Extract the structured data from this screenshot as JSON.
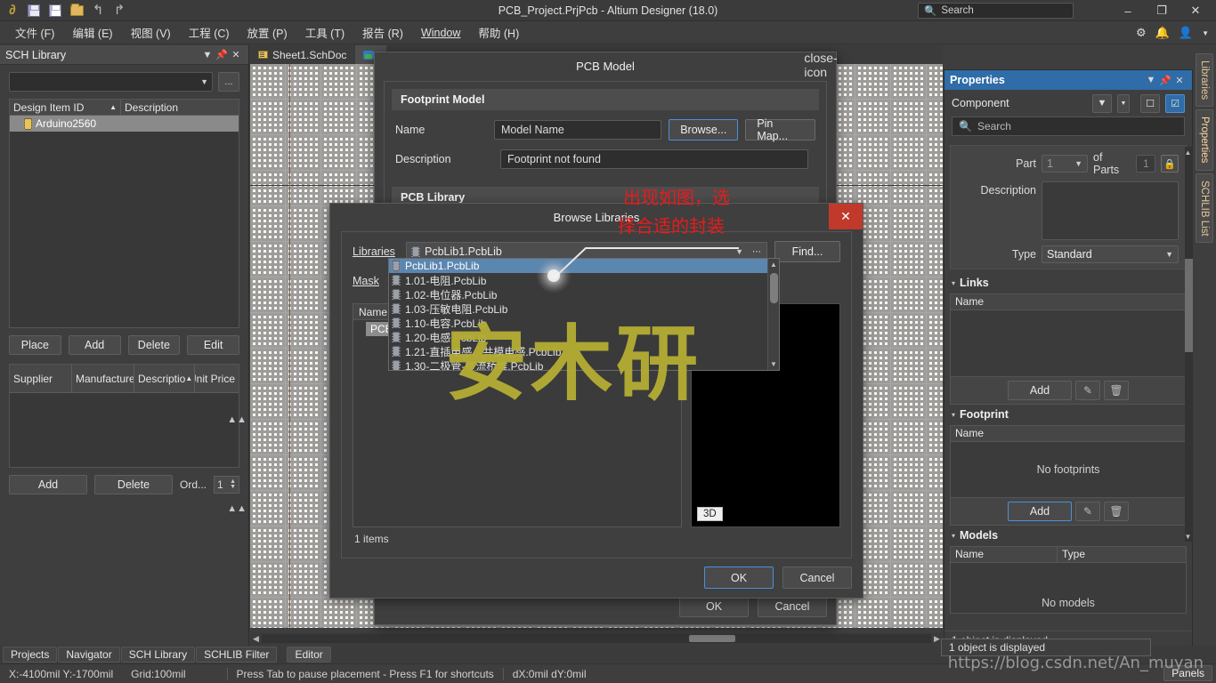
{
  "titlebar": {
    "title": "PCB_Project.PrjPcb - Altium Designer (18.0)",
    "search_placeholder": "Search",
    "search_value": "Search",
    "minimize": "–",
    "maximize": "❐",
    "close": "✕",
    "icons": [
      "altium-logo-icon",
      "save-icon",
      "save-all-icon",
      "open-folder-icon",
      "undo-icon",
      "redo-icon"
    ]
  },
  "menubar": {
    "items": [
      {
        "label": "文件 (F)"
      },
      {
        "label": "编辑 (E)"
      },
      {
        "label": "视图 (V)"
      },
      {
        "label": "工程 (C)"
      },
      {
        "label": "放置 (P)"
      },
      {
        "label": "工具 (T)"
      },
      {
        "label": "报告 (R)"
      },
      {
        "label": "Window"
      },
      {
        "label": "帮助 (H)"
      }
    ],
    "right_icons": [
      "gear-icon",
      "bell-icon",
      "user-icon",
      "chevron-down-icon"
    ]
  },
  "sch_library_panel": {
    "title": "SCH Library",
    "header_icons": [
      "chevron-down-icon",
      "pin-icon",
      "close-icon"
    ],
    "filter_value": "",
    "dots_button": "...",
    "table": {
      "columns": [
        "Design Item ID",
        "Description"
      ],
      "sort_indicator": "▲",
      "rows": [
        {
          "design_item_id": "Arduino2560",
          "description": ""
        }
      ]
    },
    "buttons_top": [
      "Place",
      "Add",
      "Delete",
      "Edit"
    ],
    "supplier_table": {
      "columns": [
        "Supplier",
        "Manufacture",
        "Descriptio",
        "Unit Price"
      ],
      "rows": []
    },
    "buttons_bottom": [
      "Add",
      "Delete"
    ],
    "order_label": "Ord...",
    "order_value": "1"
  },
  "doc_tabs": [
    {
      "label": "Sheet1.SchDoc",
      "icon": "schematic-icon",
      "active": false
    },
    {
      "label": "",
      "icon": "pcblib-icon",
      "active": true
    }
  ],
  "canvas": {
    "grid_label": "schematic-canvas"
  },
  "properties_panel": {
    "title": "Properties",
    "header_icons": [
      "chevron-down-icon",
      "pin-icon",
      "close-icon"
    ],
    "object_label": "Component",
    "filter_icon": "funnel-icon",
    "search_placeholder": "Search",
    "part_label": "Part",
    "part_value": "1",
    "of_parts_label": "of Parts",
    "of_parts_value": "1",
    "lock_icon": "lock-icon",
    "description_label": "Description",
    "description_value": "",
    "type_label": "Type",
    "type_value": "Standard",
    "sections": [
      {
        "title": "Links",
        "columns": [
          "Name"
        ],
        "empty_text": "",
        "add_label": "Add",
        "edit_icon": "pencil-icon",
        "delete_icon": "trash-icon"
      },
      {
        "title": "Footprint",
        "columns": [
          "Name"
        ],
        "empty_text": "No footprints",
        "add_label": "Add",
        "edit_icon": "pencil-icon",
        "delete_icon": "trash-icon"
      },
      {
        "title": "Models",
        "columns": [
          "Name",
          "Type"
        ],
        "empty_text": "No models",
        "add_label": "",
        "edit_icon": "pencil-icon",
        "delete_icon": "trash-icon"
      }
    ],
    "status": "1 object is displayed"
  },
  "vertical_tabs": [
    {
      "label": "Libraries"
    },
    {
      "label": "Properties"
    },
    {
      "label": "SCHLIB List"
    }
  ],
  "pcb_model_dialog": {
    "title": "PCB Model",
    "close_icon": "close-icon",
    "footprint_group": "Footprint Model",
    "name_label": "Name",
    "name_value": "Model Name",
    "browse_label": "Browse...",
    "pin_map_label": "Pin Map...",
    "description_label": "Description",
    "description_value": "Footprint not found",
    "pcb_library_group": "PCB Library",
    "ok_label": "OK",
    "cancel_label": "Cancel"
  },
  "browse_libraries_dialog": {
    "title": "Browse Libraries",
    "close_icon": "close-icon",
    "libraries_label": "Libraries",
    "libraries_value": "PcbLib1.PcbLib",
    "find_label": "Find...",
    "mask_label": "Mask",
    "mask_value": "",
    "name_column": "Name",
    "list_items": [
      "PCBC..."
    ],
    "item_count": "1 items",
    "preview_3d_label": "3D",
    "ok_label": "OK",
    "cancel_label": "Cancel",
    "dropdown": {
      "options": [
        {
          "label": "PcbLib1.PcbLib",
          "selected": true
        },
        {
          "label": "1.01-电阻.PcbLib",
          "selected": false
        },
        {
          "label": "1.02-电位器.PcbLib",
          "selected": false
        },
        {
          "label": "1.03-压敏电阻.PcbLib",
          "selected": false
        },
        {
          "label": "1.10-电容.PcbLib",
          "selected": false
        },
        {
          "label": "1.20-电感.PcbLib",
          "selected": false
        },
        {
          "label": "1.21-直插电感、共模电感.PcbLib",
          "selected": false
        },
        {
          "label": "1.30-二极管-整流桥堆.PcbLib",
          "selected": false
        }
      ]
    }
  },
  "annotation": {
    "line1": "出现如图，选",
    "line2": "择合适的封装",
    "color": "#e81b1b"
  },
  "watermark": {
    "text": "安木研",
    "color": "#b5ad33"
  },
  "blog_url": "https://blog.csdn.net/An_muyan",
  "panel_tabs": [
    {
      "label": "Projects",
      "selected": false
    },
    {
      "label": "Navigator",
      "selected": false
    },
    {
      "label": "SCH Library",
      "selected": false
    },
    {
      "label": "SCHLIB Filter",
      "selected": false
    },
    {
      "label": "Editor",
      "selected": true
    }
  ],
  "statusbar": {
    "coords": "X:-4100mil Y:-1700mil",
    "grid": "Grid:100mil",
    "hint": "Press Tab to pause placement - Press F1 for shortcuts",
    "delta": "dX:0mil dY:0mil",
    "panels_label": "Panels",
    "tooltip": "1 object is displayed"
  }
}
